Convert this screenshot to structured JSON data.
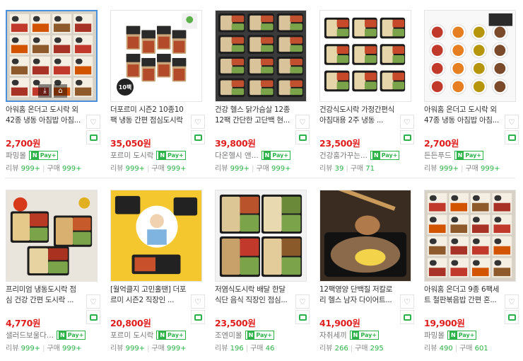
{
  "products": [
    {
      "title": "아워홈 온더고 도시락 외 42종 냉동 아침밥 아침...",
      "price": "2,700원",
      "seller": "파밍몰",
      "npay": true,
      "review_label": "리뷰",
      "review": "999+",
      "buy_label": "구매",
      "buy": "999+",
      "bg": "#b85a32"
    },
    {
      "title": "더포르미 시즌2 10종10팩 냉동 간편 점심도시락",
      "price": "35,050원",
      "seller": "포르미 도시락",
      "npay": true,
      "review_label": "리뷰",
      "review": "999+",
      "buy_label": "구매",
      "buy": "999+",
      "bg": "#f1f1f1",
      "badge": "10팩"
    },
    {
      "title": "건강 헬스 닭가슴살 12종 12팩 간단한 고단백 현...",
      "price": "39,800원",
      "seller": "다온헬시 앤...",
      "npay": true,
      "review_label": "리뷰",
      "review": "999+",
      "buy_label": "구매",
      "buy": "999+",
      "bg": "#2b2b2b"
    },
    {
      "title": "건강식도시락 가정간편식 아침대용 2주 냉동 ...",
      "price": "23,500원",
      "seller": "건강훔가꾸는...",
      "npay": true,
      "review_label": "리뷰",
      "review": "39",
      "buy_label": "구매",
      "buy": "71",
      "bg": "#ffffff"
    },
    {
      "title": "아워홈 온더고 도시락 외 47종 냉동 아침밥 아침...",
      "price": "2,700원",
      "seller": "든든푸드",
      "npay": true,
      "review_label": "리뷰",
      "review": "999+",
      "buy_label": "구매",
      "buy": "999+",
      "bg": "#f7f7f7"
    },
    {
      "title": "프리미엄 냉동도시락 점심 건강 간편 도시락 ...",
      "price": "4,770원",
      "seller": "샐러드보울다...",
      "npay": true,
      "review_label": "리뷰",
      "review": "999+",
      "buy_label": "구매",
      "buy": "999+",
      "bg": "#e9e4dc"
    },
    {
      "title": "[월억클지 고민홀땐] 더포르미 시즌2 직장인 ...",
      "price": "20,800원",
      "seller": "포르미 도시락",
      "npay": true,
      "review_label": "리뷰",
      "review": "999+",
      "buy_label": "구매",
      "buy": "999+",
      "bg": "#f4c72f"
    },
    {
      "title": "저염식도시락 배달 한달 식단 음식 직장인 점심...",
      "price": "23,500원",
      "seller": "조엔미몰",
      "npay": true,
      "review_label": "리뷰",
      "review": "196",
      "buy_label": "구매",
      "buy": "46",
      "bg": "#f2f2f2"
    },
    {
      "title": "12팩영양 단백질 저칼로리 헬스 남자 다이어트...",
      "price": "41,900원",
      "seller": "자취세끼",
      "npay": true,
      "review_label": "리뷰",
      "review": "266",
      "buy_label": "구매",
      "buy": "295",
      "bg": "#3b2c22"
    },
    {
      "title": "아워홈 온더고 9종 6팩세트 철판볶음밥 간편 혼...",
      "price": "19,900원",
      "seller": "파밍몰",
      "npay": true,
      "review_label": "리뷰",
      "review": "490",
      "buy_label": "구매",
      "buy": "601",
      "bg": "#c96a3c"
    }
  ],
  "npay_label": "Pay",
  "npay_n": "N",
  "npay_plus": "+"
}
